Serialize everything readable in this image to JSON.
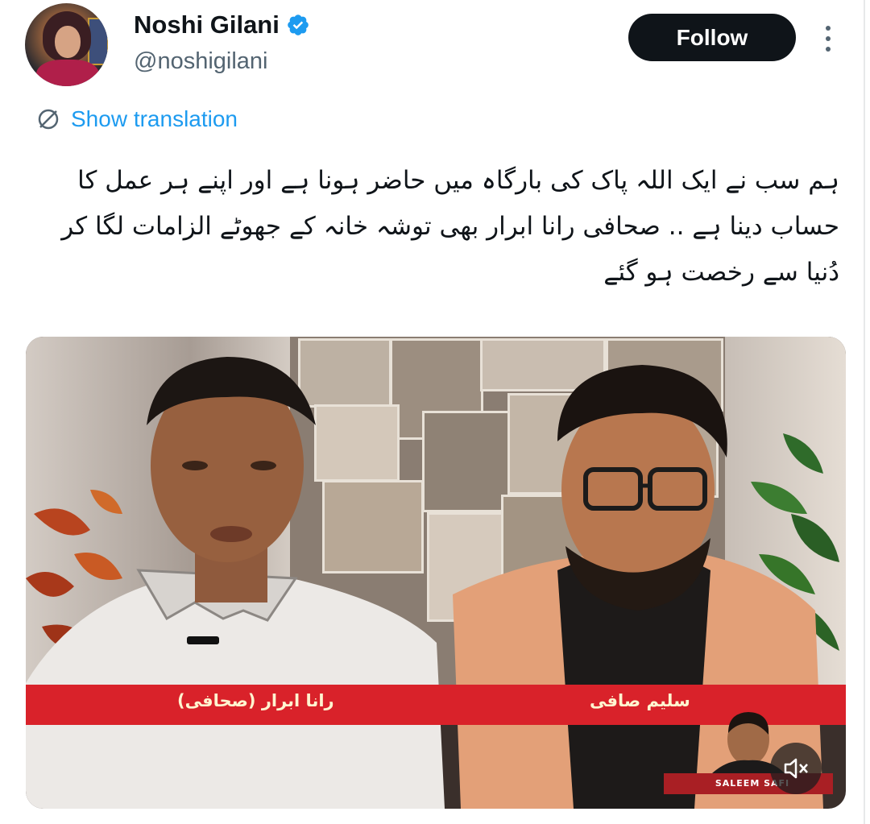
{
  "user": {
    "display_name": "Noshi Gilani",
    "handle": "@noshigilani",
    "verified": true
  },
  "actions": {
    "follow_label": "Follow",
    "more_icon": "more-vertical-icon"
  },
  "translation": {
    "label": "Show translation",
    "icon": "translate-icon"
  },
  "tweet": {
    "text": "ہم سب نے ایک اللہ پاک کی بارگاہ میں حاضر ہونا ہے اور اپنے ہر عمل کا حساب دینا ہے .. صحافی رانا ابرار بھی توشہ خانہ کے جھوٹے الزامات لگا کر دُنیا سے رخصت ہو گئے"
  },
  "media": {
    "strap_left": "رانا ابرار (صحافی)",
    "strap_right": "سلیم صافی",
    "channel_text": "SALEEM SAFI",
    "mute_icon": "mute-icon"
  },
  "colors": {
    "accent": "#1d9bf0",
    "follow_bg": "#0f1419",
    "strap_red": "#d9222a"
  }
}
